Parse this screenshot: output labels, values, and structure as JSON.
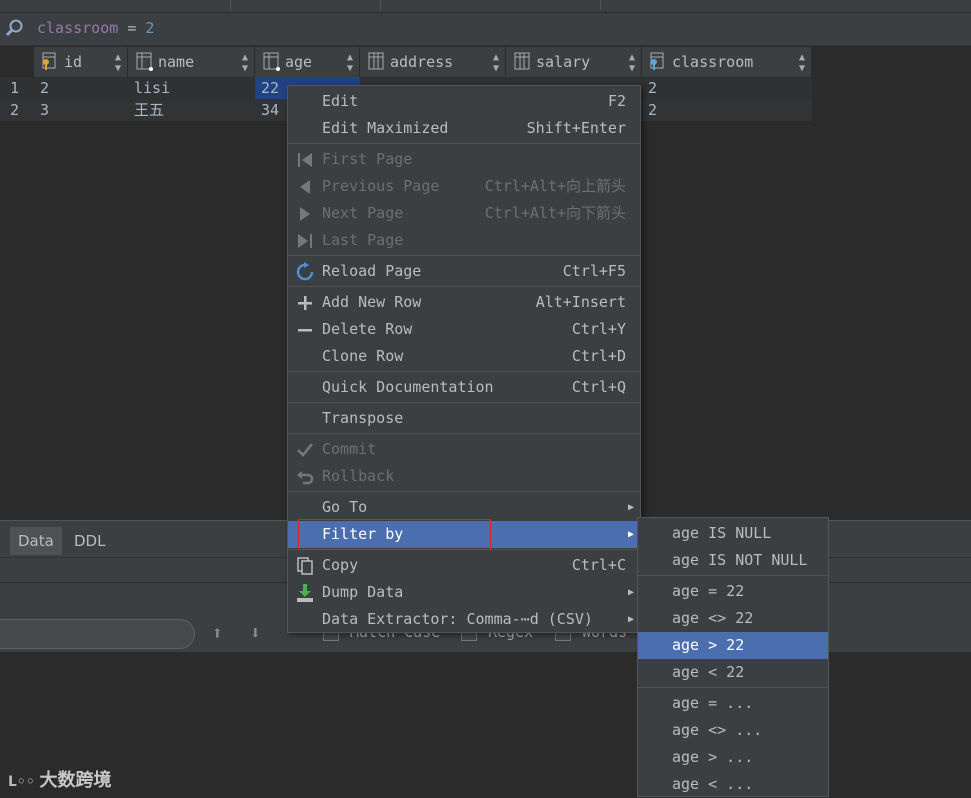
{
  "filter": {
    "field": "classroom",
    "op": "=",
    "value": "2"
  },
  "columns": [
    {
      "name": "id",
      "icon": "primary-key-column-icon"
    },
    {
      "name": "name",
      "icon": "column-index-icon"
    },
    {
      "name": "age",
      "icon": "column-index-icon"
    },
    {
      "name": "address",
      "icon": "column-icon"
    },
    {
      "name": "salary",
      "icon": "column-icon"
    },
    {
      "name": "classroom",
      "icon": "foreign-key-column-icon"
    }
  ],
  "rows": [
    {
      "num": "1",
      "id": "2",
      "name": "lisi",
      "age": "22",
      "address": "",
      "salary": "",
      "classroom": "2"
    },
    {
      "num": "2",
      "id": "3",
      "name": "王五",
      "age": "34",
      "address": "",
      "salary": "",
      "classroom": "2"
    }
  ],
  "bottom_tabs": [
    "Data",
    "DDL"
  ],
  "search_options": [
    "Match Case",
    "Regex",
    "Words"
  ],
  "context_menu": {
    "edit": {
      "label": "Edit",
      "shortcut": "F2"
    },
    "edit_max": {
      "label": "Edit Maximized",
      "shortcut": "Shift+Enter"
    },
    "first_page": {
      "label": "First Page",
      "shortcut": ""
    },
    "prev_page": {
      "label": "Previous Page",
      "shortcut": "Ctrl+Alt+向上箭头"
    },
    "next_page": {
      "label": "Next Page",
      "shortcut": "Ctrl+Alt+向下箭头"
    },
    "last_page": {
      "label": "Last Page",
      "shortcut": ""
    },
    "reload": {
      "label": "Reload Page",
      "shortcut": "Ctrl+F5"
    },
    "add_row": {
      "label": "Add New Row",
      "shortcut": "Alt+Insert"
    },
    "delete_row": {
      "label": "Delete Row",
      "shortcut": "Ctrl+Y"
    },
    "clone_row": {
      "label": "Clone Row",
      "shortcut": "Ctrl+D"
    },
    "quick_doc": {
      "label": "Quick Documentation",
      "shortcut": "Ctrl+Q"
    },
    "transpose": {
      "label": "Transpose"
    },
    "commit": {
      "label": "Commit"
    },
    "rollback": {
      "label": "Rollback"
    },
    "goto": {
      "label": "Go To"
    },
    "filter_by": {
      "label": "Filter by"
    },
    "copy": {
      "label": "Copy",
      "shortcut": "Ctrl+C"
    },
    "dump": {
      "label": "Dump Data"
    },
    "extractor": {
      "label": "Data Extractor: Comma-⋯d (CSV)"
    }
  },
  "filter_submenu": [
    "age IS NULL",
    "age IS NOT NULL",
    "age = 22",
    "age <> 22",
    "age > 22",
    "age < 22",
    "age = ...",
    "age <> ...",
    "age > ...",
    "age < ..."
  ],
  "watermark": "大数跨境"
}
